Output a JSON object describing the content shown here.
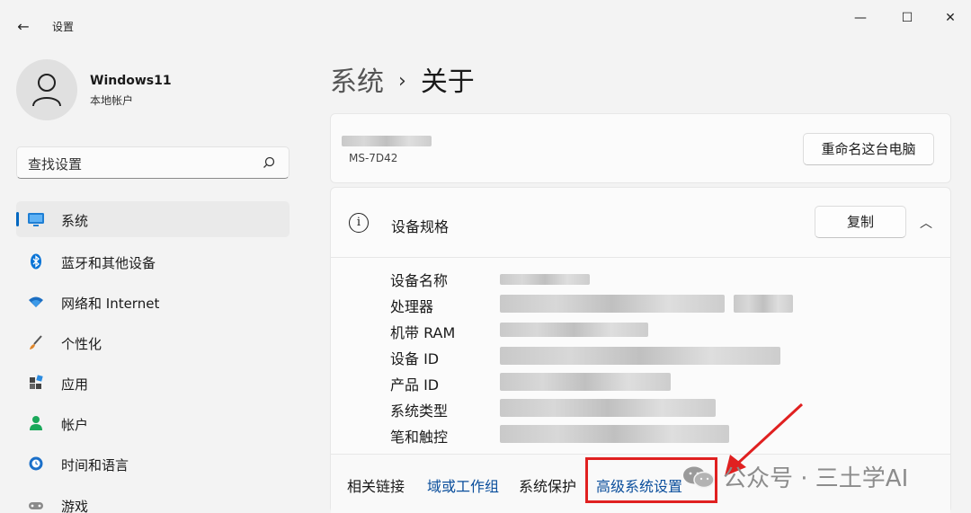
{
  "window": {
    "title": "设置",
    "back_icon": "←",
    "minimize": "—",
    "maximize": "☐",
    "close": "✕"
  },
  "profile": {
    "name": "Windows11",
    "account_type": "本地帐户"
  },
  "search": {
    "placeholder": "查找设置"
  },
  "sidebar": {
    "items": [
      {
        "label": "系统",
        "icon": "system-icon",
        "active": true
      },
      {
        "label": "蓝牙和其他设备",
        "icon": "bluetooth-icon"
      },
      {
        "label": "网络和 Internet",
        "icon": "wifi-icon"
      },
      {
        "label": "个性化",
        "icon": "brush-icon"
      },
      {
        "label": "应用",
        "icon": "apps-icon"
      },
      {
        "label": "帐户",
        "icon": "account-icon"
      },
      {
        "label": "时间和语言",
        "icon": "globe-clock-icon"
      },
      {
        "label": "游戏",
        "icon": "gamepad-icon"
      }
    ]
  },
  "breadcrumb": {
    "parent": "系统",
    "separator": "›",
    "current": "关于"
  },
  "device": {
    "model": "MS-7D42",
    "rename_label": "重命名这台电脑"
  },
  "specs": {
    "title": "设备规格",
    "copy_label": "复制",
    "collapse_icon": "chevron-up-icon",
    "rows": [
      {
        "label": "设备名称"
      },
      {
        "label": "处理器"
      },
      {
        "label": "机带 RAM"
      },
      {
        "label": "设备 ID"
      },
      {
        "label": "产品 ID"
      },
      {
        "label": "系统类型"
      },
      {
        "label": "笔和触控"
      }
    ]
  },
  "related_links": {
    "label": "相关链接",
    "domain": "域或工作组",
    "protection": "系统保护",
    "advanced": "高级系统设置"
  },
  "watermark": {
    "text": "公众号 · 三土学AI"
  },
  "colors": {
    "accent": "#0067c0",
    "annotation": "#e02020",
    "link": "#0a4e9c"
  }
}
